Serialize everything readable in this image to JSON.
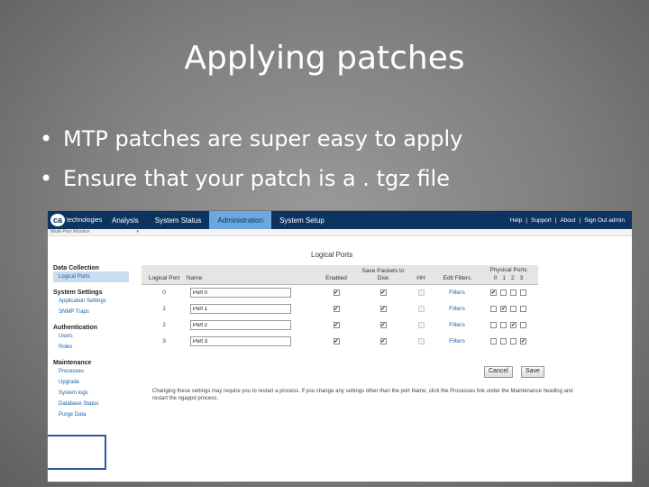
{
  "slide": {
    "title": "Applying patches",
    "bullets": [
      "MTP patches are super easy to apply",
      "Ensure that your patch is a . tgz file"
    ]
  },
  "app": {
    "logo_mark": "ca",
    "logo_text": "technologies",
    "nav_tabs": [
      "Analysis",
      "System Status",
      "Administration",
      "System Setup"
    ],
    "active_tab": "Administration",
    "top_links": [
      "Help",
      "|",
      "Support",
      "|",
      "About",
      "|",
      "Sign Out admin"
    ],
    "subbar_label": "Multi-Port Monitor",
    "subbar_arrow": "▾",
    "sidebar": {
      "data_collection": {
        "heading": "Data Collection",
        "items": [
          "Logical Ports"
        ]
      },
      "system_settings": {
        "heading": "System Settings",
        "items": [
          "Application Settings",
          "SNMP Traps"
        ]
      },
      "authentication": {
        "heading": "Authentication",
        "items": [
          "Users",
          "Roles"
        ]
      },
      "maintenance": {
        "heading": "Maintenance",
        "items": [
          "Processes",
          "Upgrade",
          "System logs",
          "Database Status",
          "Purge Data"
        ]
      }
    },
    "main_title": "Logical Ports",
    "table": {
      "headers": {
        "logical_port": "Logical Port",
        "name": "Name",
        "enabled": "Enabled",
        "save_packets": "Save Packets to Disk",
        "hh": "HH",
        "edit_filters": "Edit Filters",
        "physical_ports": "Physical Ports",
        "physical_indices": [
          "0",
          "1",
          "2",
          "3"
        ]
      },
      "rows": [
        {
          "port": "0",
          "name": "Port 0",
          "filters": "Filters"
        },
        {
          "port": "1",
          "name": "Port 1",
          "filters": "Filters"
        },
        {
          "port": "2",
          "name": "Port 2",
          "filters": "Filters"
        },
        {
          "port": "3",
          "name": "Port 3",
          "filters": "Filters"
        }
      ]
    },
    "checkbox_mark": "✔",
    "buttons": {
      "cancel": "Cancel",
      "save": "Save"
    },
    "note": "Changing these settings may require you to restart a process. If you change any settings other than the port Name, click the Processes link under the Maintenance heading and restart the ngappd process."
  }
}
